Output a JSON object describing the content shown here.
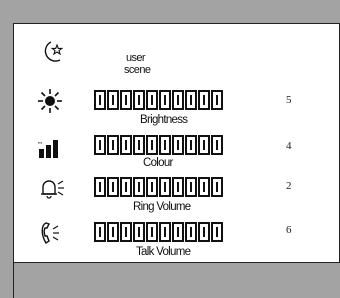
{
  "header": {
    "user_label": "user",
    "scene_label": "scene"
  },
  "rows": [
    {
      "name": "Brightness",
      "value": "5",
      "icon": "brightness-icon"
    },
    {
      "name": "Colour",
      "value": "4",
      "icon": "colour-bars-icon"
    },
    {
      "name": "Ring Volume",
      "value": "2",
      "icon": "bell-icon"
    },
    {
      "name": "Talk Volume",
      "value": "6",
      "icon": "handset-icon"
    }
  ],
  "segments_per_bar": 10,
  "icons": {
    "user_scene": "moon-star-icon"
  }
}
